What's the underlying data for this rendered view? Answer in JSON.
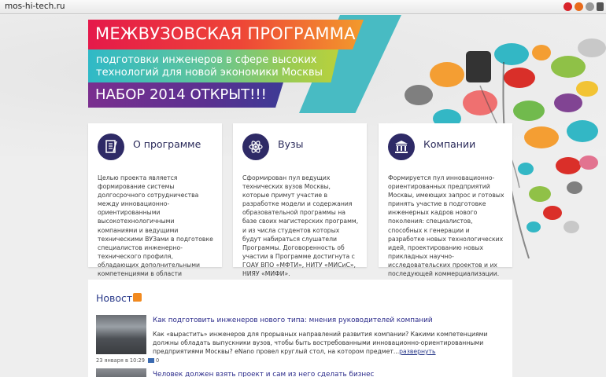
{
  "browser": {
    "url": "mos-hi-tech.ru"
  },
  "banner": {
    "line1": "МЕЖВУЗОВСКАЯ ПРОГРАММА",
    "line2a": "подготовки инженеров в сфере высоких",
    "line2b": "технологий для новой экономики Москвы",
    "line3": "НАБОР 2014 ОТКРЫТ!!!"
  },
  "cards": [
    {
      "title": "О программе",
      "icon": "document-icon",
      "text": "Целью проекта является формирование системы долгосрочного сотрудничества между инновационно-ориентированными высокотехнологичными компаниями и ведущими техническими ВУЗами в подготовке специалистов инженерно-технического профиля, обладающих дополнительными компетенциями в области технологического предпринимательства и инновационного развития бизнеса."
    },
    {
      "title": "Вузы",
      "icon": "atom-icon",
      "text": "Сформирован пул ведущих технических вузов Москвы, которые примут участие в разработке модели и содержания образовательной программы на базе своих магистерских программ, и из числа студентов которых будут набираться слушатели Программы. Договоренность об участии в Программе достигнута с ГОАУ ВПО «МФТИ», НИТУ «МИСиС», НИЯУ «МИФИ»."
    },
    {
      "title": "Компании",
      "icon": "building-icon",
      "text": "Формируется пул инновационно-ориентированных предприятий Москвы, имеющих запрос и готовых принять участие в подготовке инженерных кадров нового поколения: специалистов, способных к генерации и разработке новых технологических идей, проектированию новых прикладных научно- исследовательских проектов и их последующей коммерциализации."
    }
  ],
  "news": {
    "title": "Новости",
    "items": [
      {
        "title": "Как подготовить инженеров нового типа: мнения руководителей компаний",
        "text": "Как «вырастить» инженеров для прорывных направлений развития компании? Какими компетенциями должны обладать выпускники вузов, чтобы быть востребованными инновационно-ориентированными предприятиями Москвы? eNano провел круглый стол, на котором предмет...",
        "expand": "развернуть",
        "date": "23 января в 10:29",
        "comments": "0"
      },
      {
        "title": "Человек должен взять проект и сам из него сделать бизнес"
      }
    ]
  },
  "colors": {
    "accent_red": "#e5194a",
    "accent_teal": "#2fb9c7",
    "accent_purple": "#5b3090",
    "icon_bg": "#2e2a66"
  }
}
